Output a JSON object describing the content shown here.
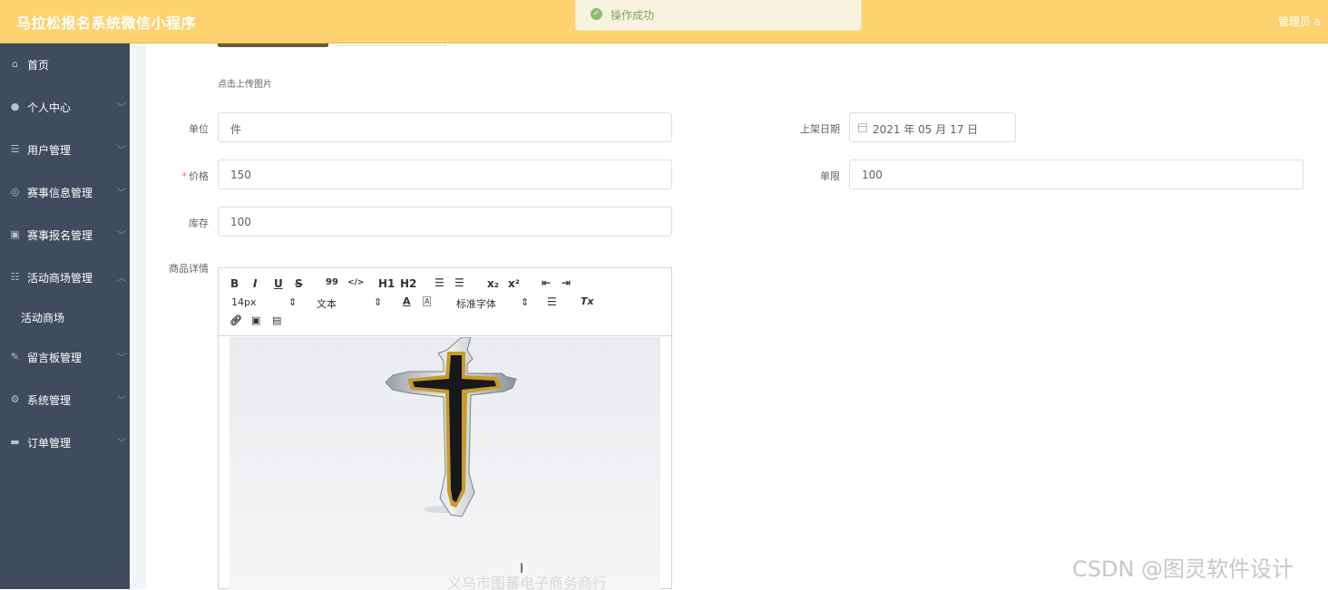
{
  "header": {
    "title": "马拉松报名系统微信小程序",
    "user": "管理员 a"
  },
  "toast": {
    "text": "操作成功"
  },
  "sidebar": {
    "items": [
      {
        "label": "首页",
        "icon": "home-icon",
        "arrow": ""
      },
      {
        "label": "个人中心",
        "icon": "person-icon",
        "arrow": "﹀"
      },
      {
        "label": "用户管理",
        "icon": "list-icon",
        "arrow": "﹀"
      },
      {
        "label": "赛事信息管理",
        "icon": "globe-icon",
        "arrow": "﹀"
      },
      {
        "label": "赛事报名管理",
        "icon": "clipboard-icon",
        "arrow": "﹀"
      },
      {
        "label": "活动商场管理",
        "icon": "sliders-icon",
        "arrow": "︿"
      },
      {
        "label": "活动商场",
        "icon": "",
        "arrow": ""
      },
      {
        "label": "留言板管理",
        "icon": "pen-icon",
        "arrow": "﹀"
      },
      {
        "label": "系统管理",
        "icon": "settings-icon",
        "arrow": "﹀"
      },
      {
        "label": "订单管理",
        "icon": "monitor-icon",
        "arrow": "﹀"
      }
    ]
  },
  "form": {
    "upload_hint": "点击上传图片",
    "unit": {
      "label": "单位",
      "value": "件"
    },
    "shelf_date": {
      "label": "上架日期",
      "value": "2021 年 05 月 17 日"
    },
    "price": {
      "required": "*",
      "label": "价格",
      "value": "150"
    },
    "limit": {
      "label": "单限",
      "value": "100"
    },
    "stock": {
      "label": "库存",
      "value": "100"
    },
    "detail": {
      "label": "商品详情"
    }
  },
  "editor": {
    "row1": [
      "B",
      "I",
      "U",
      "S",
      "99",
      "</>",
      "H1",
      "H2",
      "ol-list",
      "ul-list",
      "x₂",
      "x²",
      "outdent",
      "indent"
    ],
    "font_size": "14px",
    "paragraph": "文本",
    "font_family": "标准字体",
    "color_label": "A",
    "bg_label": "A",
    "clear_label": "Tx",
    "image_watermark": "义乌市图蕃电子商务商行"
  },
  "watermark": "CSDN @图灵软件设计",
  "colors": {
    "header": "#fdd26f",
    "sidebar": "#404b5e",
    "success": "#8bbd6a"
  }
}
